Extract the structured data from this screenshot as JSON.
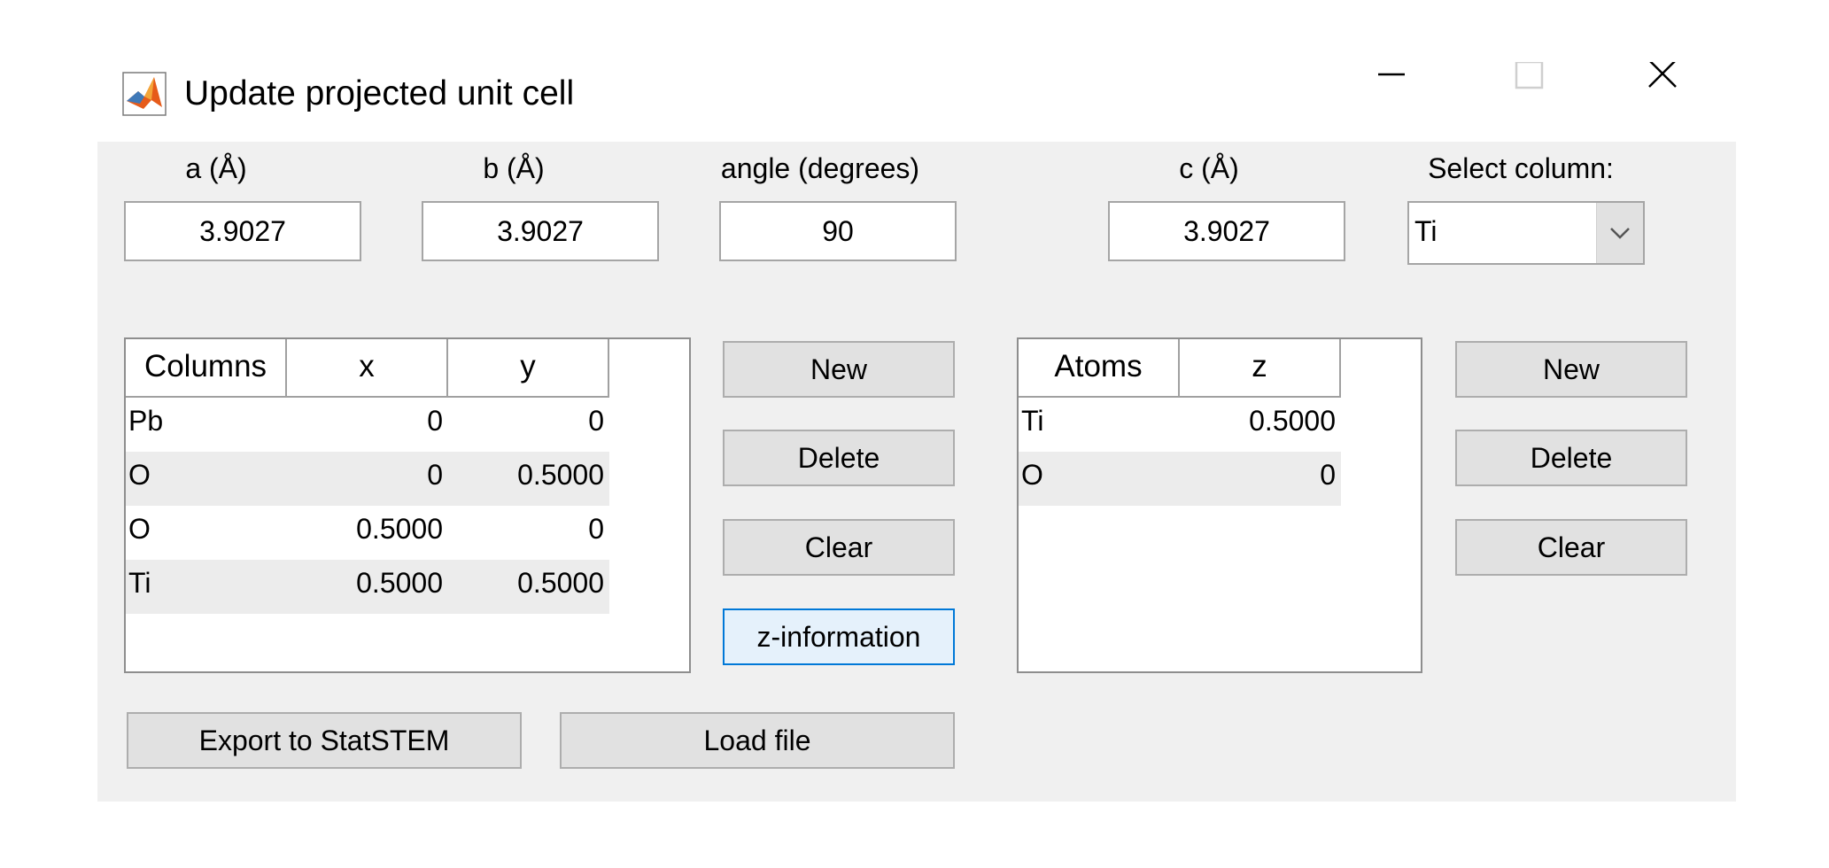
{
  "window": {
    "title": "Update projected unit cell",
    "icon": "matlab-icon",
    "controls": {
      "minimize_icon": "minimize-icon",
      "maximize_icon": "maximize-icon",
      "close_icon": "close-icon"
    }
  },
  "params": {
    "a_label": "a (Å)",
    "a_value": "3.9027",
    "b_label": "b (Å)",
    "b_value": "3.9027",
    "angle_label": "angle (degrees)",
    "angle_value": "90",
    "c_label": "c (Å)",
    "c_value": "3.9027",
    "select_label": "Select column:",
    "select_value": "Ti"
  },
  "columns_table": {
    "headers": [
      "Columns",
      "x",
      "y"
    ],
    "rows": [
      [
        "Pb",
        "0",
        "0"
      ],
      [
        "O",
        "0",
        "0.5000"
      ],
      [
        "O",
        "0.5000",
        "0"
      ],
      [
        "Ti",
        "0.5000",
        "0.5000"
      ]
    ]
  },
  "columns_buttons": {
    "new": "New",
    "delete": "Delete",
    "clear": "Clear",
    "z_information": "z-information"
  },
  "atoms_table": {
    "headers": [
      "Atoms",
      "z"
    ],
    "rows": [
      [
        "Ti",
        "0.5000"
      ],
      [
        "O",
        "0"
      ]
    ]
  },
  "atoms_buttons": {
    "new": "New",
    "delete": "Delete",
    "clear": "Clear"
  },
  "footer": {
    "export": "Export to StatSTEM",
    "load": "Load file"
  },
  "colors": {
    "panel_background": "#f0f0f0",
    "focused_border": "#0078d7",
    "focused_background": "#e5f1fb",
    "button_background": "#e1e1e1"
  }
}
